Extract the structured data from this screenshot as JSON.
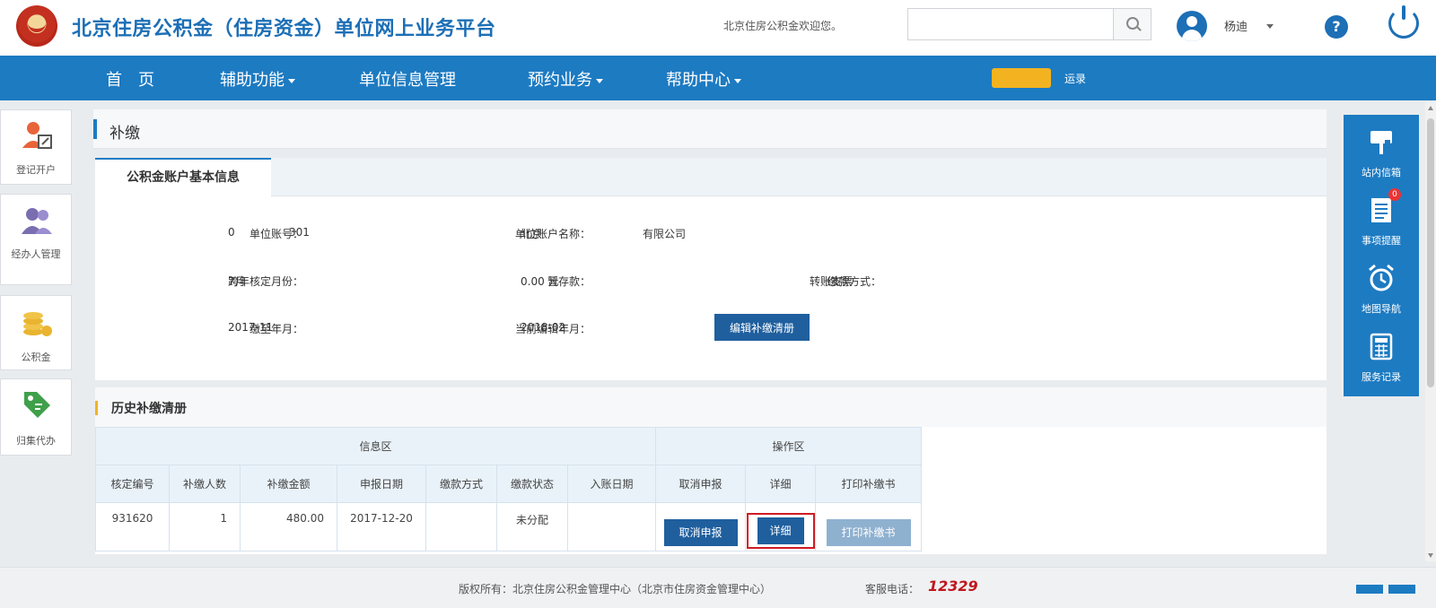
{
  "header": {
    "title": "北京住房公积金（住房资金）单位网上业务平台",
    "welcome": "北京住房公积金欢迎您。",
    "search_placeholder": "",
    "user_name": "杨迪",
    "help_glyph": "?"
  },
  "nav": {
    "items": [
      {
        "label": "首　页"
      },
      {
        "label": "辅助功能"
      },
      {
        "label": "单位信息管理"
      },
      {
        "label": "预约业务"
      },
      {
        "label": "帮助中心"
      }
    ],
    "badge": "",
    "extra": "运录"
  },
  "left_sidebar": {
    "items": [
      {
        "label": "登记开户"
      },
      {
        "label": "经办人管理"
      },
      {
        "label": "公积金"
      },
      {
        "label": "归集代办"
      }
    ]
  },
  "page": {
    "title": "补缴"
  },
  "account_info": {
    "tab": "公积金账户基本信息",
    "fields": {
      "unit_no_label": "单位账号：",
      "unit_no_value_a": "0",
      "unit_no_value_b": "301",
      "unit_name_label": "单位账户名称：",
      "unit_name_value_a": "北京",
      "unit_name_value_b": "有限公司",
      "cross_year_label": "跨年核定月份：",
      "cross_year_value": "7月",
      "deposit_label": "暂存款：",
      "deposit_value": "0.00 元",
      "payment_method_label": "缴款方式：",
      "payment_method_value": "转账支票",
      "paid_to_label": "缴至年月：",
      "paid_to_value": "2017-11",
      "current_month_label": "当前编辑年月：",
      "current_month_value": "2018-02"
    },
    "edit_button": "编辑补缴清册"
  },
  "history": {
    "title": "历史补缴清册",
    "group_info": "信息区",
    "group_ops": "操作区",
    "columns": [
      "核定编号",
      "补缴人数",
      "补缴金额",
      "申报日期",
      "缴款方式",
      "缴款状态",
      "入账日期",
      "取消申报",
      "详细",
      "打印补缴书"
    ],
    "rows": [
      {
        "id": "931620",
        "count": "1",
        "amount": "480.00",
        "date": "2017-12-20",
        "method": "",
        "status": "未分配",
        "entry_date": "",
        "cancel_label": "取消申报",
        "detail_label": "详细",
        "print_label": "打印补缴书"
      }
    ]
  },
  "right_toolbar": {
    "items": [
      {
        "label": "站内信箱"
      },
      {
        "label": "事项提醒"
      },
      {
        "label": "地图导航"
      },
      {
        "label": "服务记录"
      }
    ],
    "notification_count": "0"
  },
  "footer": {
    "copyright": "版权所有：北京住房公积金管理中心（北京市住房资金管理中心）",
    "tel_label": "客服电话：",
    "tel": "12329"
  },
  "colors": {
    "brand_blue": "#1d7bc2",
    "title_blue": "#1d6fb6",
    "button_blue": "#1f5f9e",
    "accent_yellow": "#f3b321",
    "highlight_red": "#c0161c"
  }
}
